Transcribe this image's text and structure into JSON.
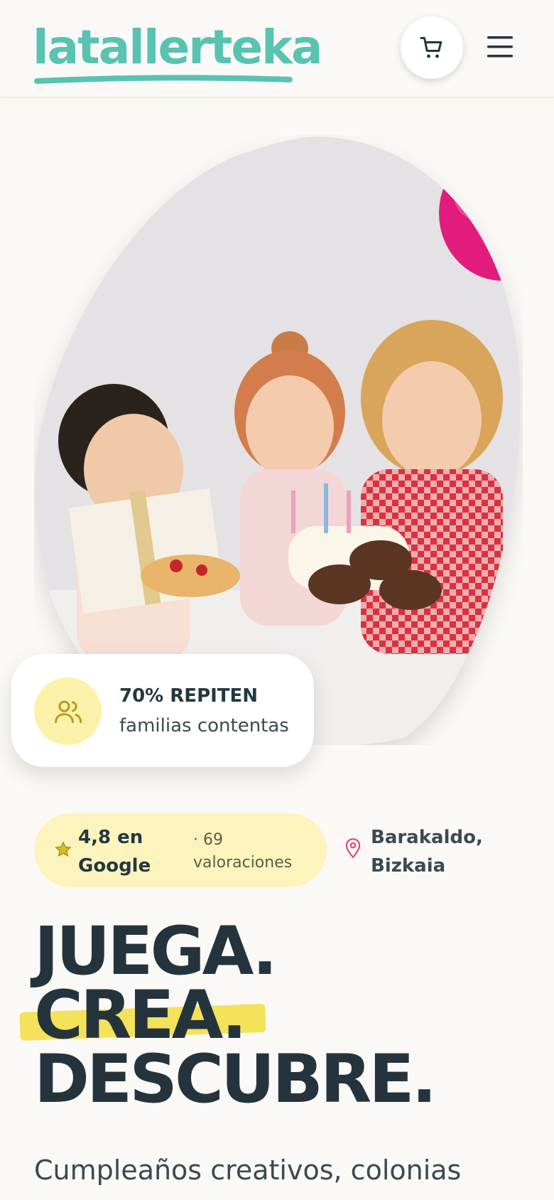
{
  "header": {
    "logo_text": "latallerteka",
    "cart_icon": "cart-icon",
    "menu_icon": "hamburger-menu-icon"
  },
  "hero": {
    "image_alt": "Niños celebrando un cumpleaños con tarta, donuts y globo",
    "stat_icon": "users-icon",
    "stat_title": "70% REPITEN",
    "stat_subtitle": "familias contentas"
  },
  "rating": {
    "icon": "star-icon",
    "score_text": "4,8 en Google",
    "count_text": "· 69 valoraciones"
  },
  "location": {
    "icon": "map-pin-icon",
    "text": "Barakaldo, Bizkaia"
  },
  "headline": {
    "line1": "JUEGA.",
    "line2": "CREA.",
    "line3": "DESCUBRE."
  },
  "subtitle": "Cumpleaños creativos, colonias",
  "colors": {
    "brand_teal": "#58c3b1",
    "highlight_yellow": "#f5e25b",
    "pill_yellow": "#fdf4bd",
    "text_dark": "#25343c",
    "pin_pink": "#e0457b"
  }
}
